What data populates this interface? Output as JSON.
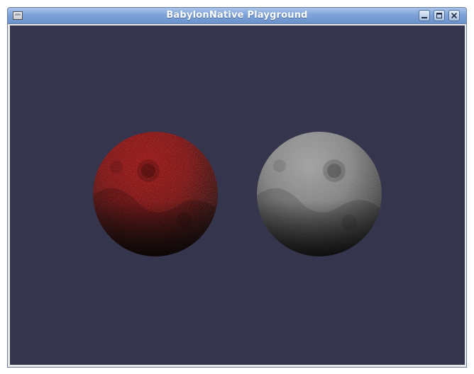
{
  "window": {
    "title": "BabylonNative Playground",
    "buttons": {
      "minimize": "minimize-icon",
      "maximize": "maximize-icon",
      "close": "close-icon"
    }
  },
  "scene": {
    "background_color": "#35354d",
    "spheres": [
      {
        "name": "red-textured-sphere",
        "tint": "#a00000",
        "texture": "moon-craters"
      },
      {
        "name": "gray-textured-sphere",
        "tint": "#9a9a9a",
        "texture": "moon-craters"
      }
    ]
  }
}
